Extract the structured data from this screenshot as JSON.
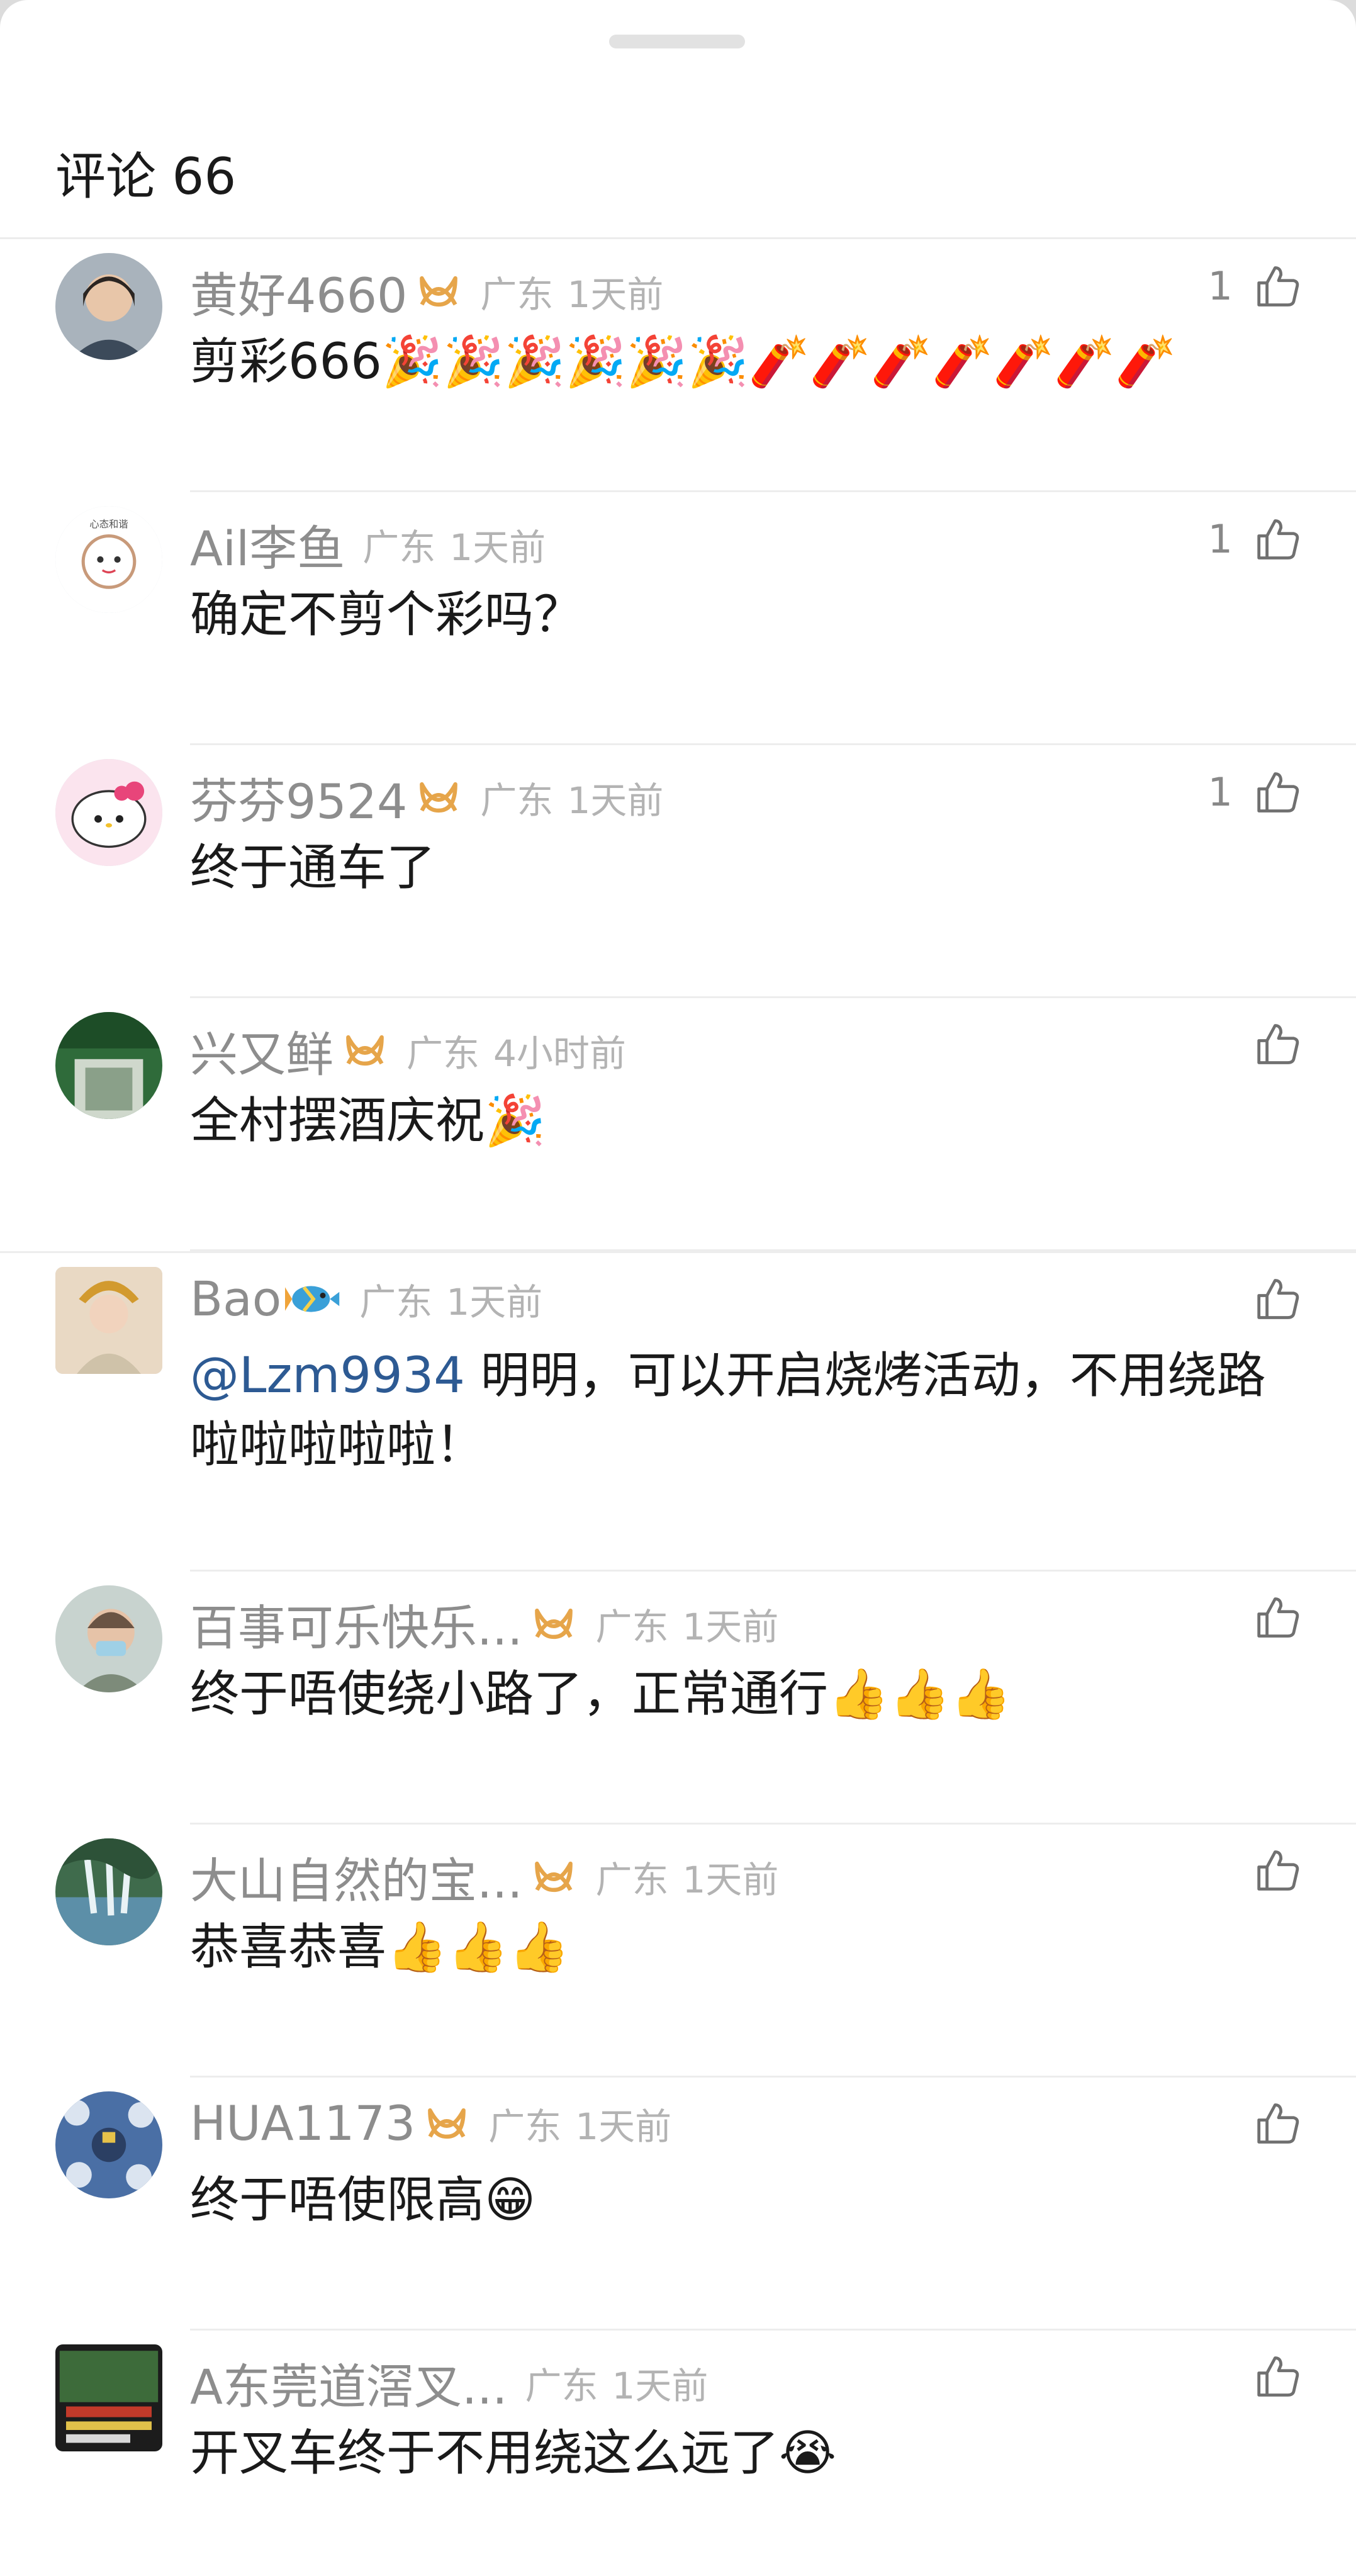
{
  "header": {
    "title": "评论 66"
  },
  "comments": [
    {
      "name": "黄好4660",
      "location": "广东",
      "time": "1天前",
      "likes": "1",
      "text": "剪彩666🎉🎉🎉🎉🎉🎉🧨🧨🧨🧨🧨🧨🧨"
    },
    {
      "name": "Ail李鱼",
      "location": "广东",
      "time": "1天前",
      "likes": "1",
      "text": "确定不剪个彩吗？"
    },
    {
      "name": "芬芬9524",
      "location": "广东",
      "time": "1天前",
      "likes": "1",
      "text": "终于通车了"
    },
    {
      "name": "兴又鲜",
      "location": "广东",
      "time": "4小时前",
      "likes": "",
      "text": "全村摆酒庆祝🎉"
    },
    {
      "name": "Bao",
      "location": "广东",
      "time": "1天前",
      "likes": "",
      "mention": "@Lzm9934",
      "text": " 明明，可以开启烧烤活动，不用绕路啦啦啦啦啦！"
    },
    {
      "name": "百事可乐快乐...",
      "location": "广东",
      "time": "1天前",
      "likes": "",
      "text": "终于唔使绕小路了，正常通行👍👍👍"
    },
    {
      "name": "大山自然的宝...",
      "location": "广东",
      "time": "1天前",
      "likes": "",
      "text": "恭喜恭喜👍👍👍"
    },
    {
      "name": "HUA1173",
      "location": "广东",
      "time": "1天前",
      "likes": "",
      "text": "终于唔使限高😁"
    },
    {
      "name": "A东莞道滘叉...",
      "location": "广东",
      "time": "1天前",
      "likes": "",
      "text": "开叉车终于不用绕这么远了😭"
    }
  ],
  "colors": {
    "name": "#8d8d8d",
    "meta": "#b3b3b3",
    "mention": "#2d5a93",
    "badge": "#e6a54a"
  },
  "icons": {
    "like": "thumbs-up-icon",
    "badge": "vip-badge-icon",
    "fish": "fish-icon"
  }
}
